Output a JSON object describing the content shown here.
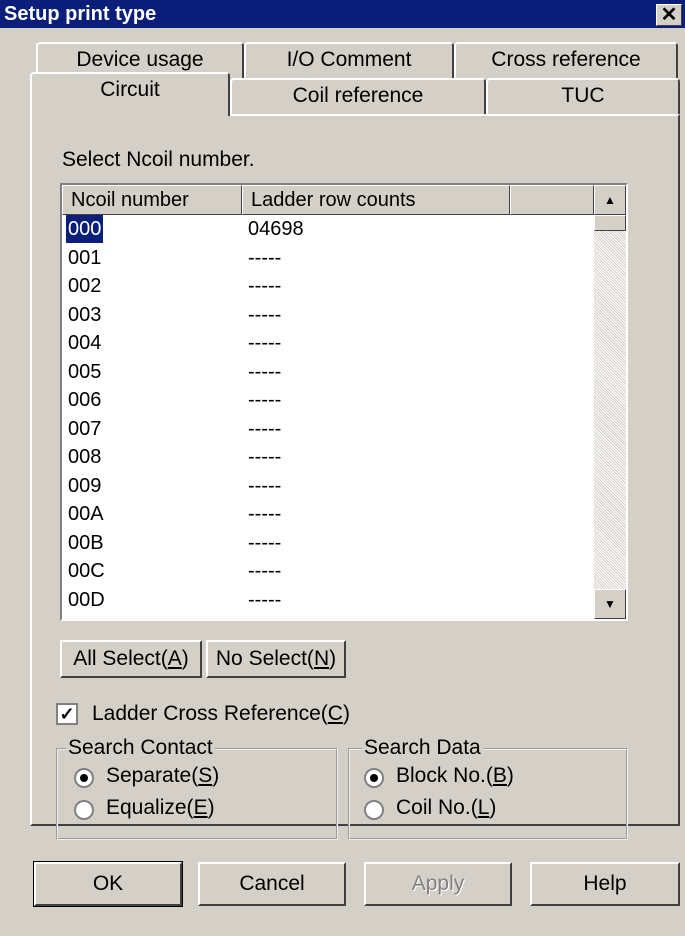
{
  "window": {
    "title": "Setup print type",
    "close_glyph": "✕"
  },
  "tabs_back": [
    "Device usage",
    "I/O Comment",
    "Cross reference"
  ],
  "tabs_front": [
    "Circuit",
    "Coil reference",
    "TUC"
  ],
  "selected_tab": "Circuit",
  "prompt": "Select Ncoil number.",
  "list": {
    "columns": [
      "Ncoil number",
      "Ladder row counts"
    ],
    "rows": [
      [
        "000",
        "04698"
      ],
      [
        "001",
        "-----"
      ],
      [
        "002",
        "-----"
      ],
      [
        "003",
        "-----"
      ],
      [
        "004",
        "-----"
      ],
      [
        "005",
        "-----"
      ],
      [
        "006",
        "-----"
      ],
      [
        "007",
        "-----"
      ],
      [
        "008",
        "-----"
      ],
      [
        "009",
        "-----"
      ],
      [
        "00A",
        "-----"
      ],
      [
        "00B",
        "-----"
      ],
      [
        "00C",
        "-----"
      ],
      [
        "00D",
        "-----"
      ]
    ],
    "selected_row": "000"
  },
  "buttons": {
    "all_select": {
      "text": "All Select(",
      "key": "A",
      "end": ")"
    },
    "no_select": {
      "text": "No Select(",
      "key": "N",
      "end": ")"
    }
  },
  "ladder_checkbox": {
    "text": "Ladder Cross Reference(",
    "key": "C",
    "end": ")",
    "checked": true
  },
  "search_contact": {
    "title": "Search Contact",
    "options": [
      {
        "text": "Separate(",
        "key": "S",
        "end": ")",
        "selected": true
      },
      {
        "text": "Equalize(",
        "key": "E",
        "end": ")",
        "selected": false
      }
    ]
  },
  "search_data": {
    "title": "Search Data",
    "options": [
      {
        "text": "Block No.(",
        "key": "B",
        "end": ")",
        "selected": true
      },
      {
        "text": "Coil No.(",
        "key": "L",
        "end": ")",
        "selected": false
      }
    ]
  },
  "footer": {
    "ok": "OK",
    "cancel": "Cancel",
    "apply": "Apply",
    "help": "Help"
  }
}
